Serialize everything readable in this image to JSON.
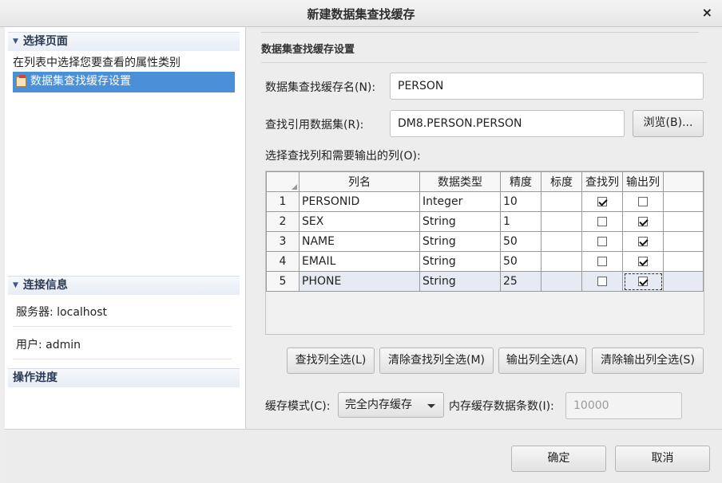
{
  "window": {
    "title": "新建数据集查找缓存",
    "close_glyph": "×"
  },
  "left": {
    "select_page": {
      "header": "选择页面",
      "hint": "在列表中选择您要查看的属性类别",
      "items": [
        {
          "label": "数据集查找缓存设置",
          "selected": true
        }
      ]
    },
    "connection": {
      "header": "连接信息",
      "server": "服务器: localhost",
      "user": "用户: admin"
    },
    "progress": {
      "header": "操作进度"
    }
  },
  "form": {
    "section_title": "数据集查找缓存设置",
    "name_label": "数据集查找缓存名(N):",
    "name_value": "PERSON",
    "ref_label": "查找引用数据集(R):",
    "ref_value": "DM8.PERSON.PERSON",
    "browse_label": "浏览(B)...",
    "columns_label": "选择查找列和需要输出的列(O):",
    "table": {
      "headers": [
        "列名",
        "数据类型",
        "精度",
        "标度",
        "查找列",
        "输出列"
      ],
      "rows": [
        {
          "num": "1",
          "name": "PERSONID",
          "type": "Integer",
          "precision": "10",
          "scale": "",
          "lookup": true,
          "output": false
        },
        {
          "num": "2",
          "name": "SEX",
          "type": "String",
          "precision": "1",
          "scale": "",
          "lookup": false,
          "output": true
        },
        {
          "num": "3",
          "name": "NAME",
          "type": "String",
          "precision": "50",
          "scale": "",
          "lookup": false,
          "output": true
        },
        {
          "num": "4",
          "name": "EMAIL",
          "type": "String",
          "precision": "50",
          "scale": "",
          "lookup": false,
          "output": true
        },
        {
          "num": "5",
          "name": "PHONE",
          "type": "String",
          "precision": "25",
          "scale": "",
          "lookup": false,
          "output": true
        }
      ]
    },
    "buttons": {
      "select_all_lookup": "查找列全选(L)",
      "clear_all_lookup": "清除查找列全选(M)",
      "select_all_output": "输出列全选(A)",
      "clear_all_output": "清除输出列全选(S)"
    },
    "cache_mode_label": "缓存模式(C):",
    "cache_mode_value": "完全内存缓存",
    "mem_count_label": "内存缓存数据条数(I):",
    "mem_count_value": "10000"
  },
  "footer": {
    "ok": "确定",
    "cancel": "取消"
  }
}
